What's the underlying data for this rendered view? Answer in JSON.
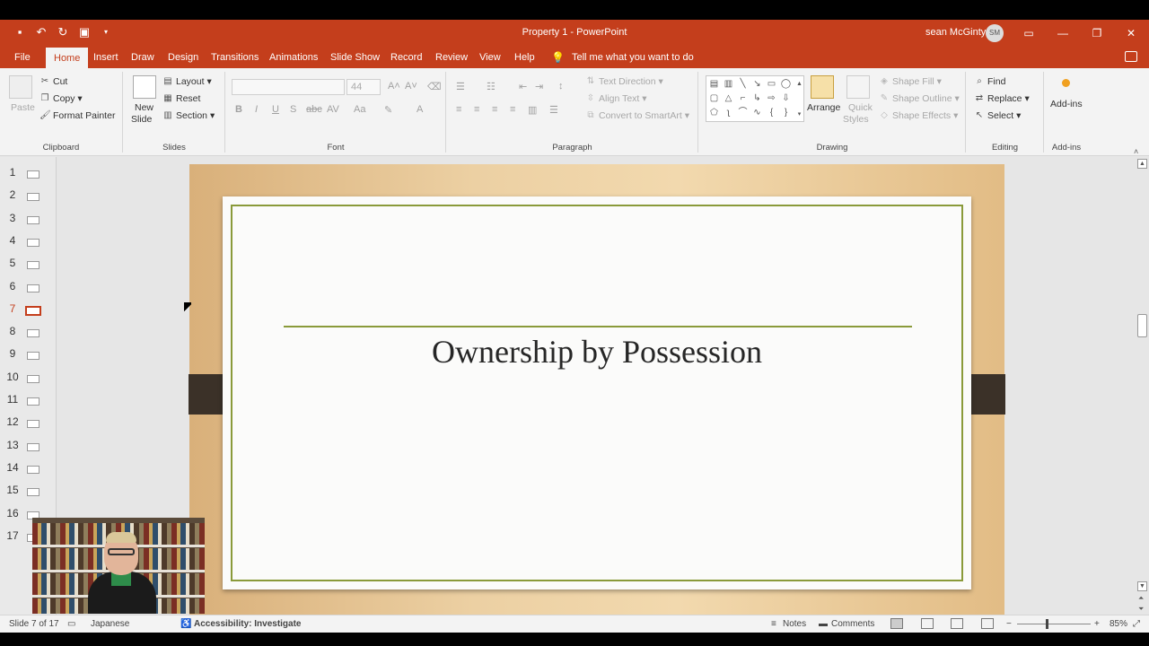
{
  "titlebar": {
    "title": "Property 1  -  PowerPoint",
    "user_name": "sean McGinty",
    "user_initials": "SM"
  },
  "tabs": [
    "File",
    "Home",
    "Insert",
    "Draw",
    "Design",
    "Transitions",
    "Animations",
    "Slide Show",
    "Record",
    "Review",
    "View",
    "Help"
  ],
  "tell_me": "Tell me what you want to do",
  "ribbon": {
    "clipboard": {
      "label": "Clipboard",
      "paste": "Paste",
      "cut": "Cut",
      "copy": "Copy",
      "format_painter": "Format Painter"
    },
    "slides": {
      "label": "Slides",
      "new_slide": "New",
      "new_slide_2": "Slide",
      "layout": "Layout",
      "reset": "Reset",
      "section": "Section"
    },
    "font": {
      "label": "Font",
      "font_size": "44"
    },
    "paragraph": {
      "label": "Paragraph",
      "text_direction": "Text Direction",
      "align_text": "Align Text",
      "convert_smartart": "Convert to SmartArt"
    },
    "drawing": {
      "label": "Drawing",
      "arrange": "Arrange",
      "quick_styles": "Quick",
      "quick_styles_2": "Styles",
      "shape_fill": "Shape Fill",
      "shape_outline": "Shape Outline",
      "shape_effects": "Shape Effects"
    },
    "editing": {
      "label": "Editing",
      "find": "Find",
      "replace": "Replace",
      "select": "Select"
    },
    "addins": {
      "label": "Add-ins",
      "addins": "Add-ins"
    }
  },
  "thumbnails": [
    {
      "n": "1"
    },
    {
      "n": "2"
    },
    {
      "n": "3"
    },
    {
      "n": "4"
    },
    {
      "n": "5"
    },
    {
      "n": "6"
    },
    {
      "n": "7",
      "active": true
    },
    {
      "n": "8"
    },
    {
      "n": "9"
    },
    {
      "n": "10"
    },
    {
      "n": "11"
    },
    {
      "n": "12"
    },
    {
      "n": "13"
    },
    {
      "n": "14"
    },
    {
      "n": "15"
    },
    {
      "n": "16"
    },
    {
      "n": "17"
    }
  ],
  "slide": {
    "title": "Ownership by Possession"
  },
  "status": {
    "slide_info": "Slide 7 of 17",
    "language": "Japanese",
    "accessibility": "Accessibility: Investigate",
    "notes": "Notes",
    "comments": "Comments",
    "zoom": "85%"
  },
  "colors": {
    "accent": "#c43e1c",
    "slide_border": "#8a9a3a"
  }
}
